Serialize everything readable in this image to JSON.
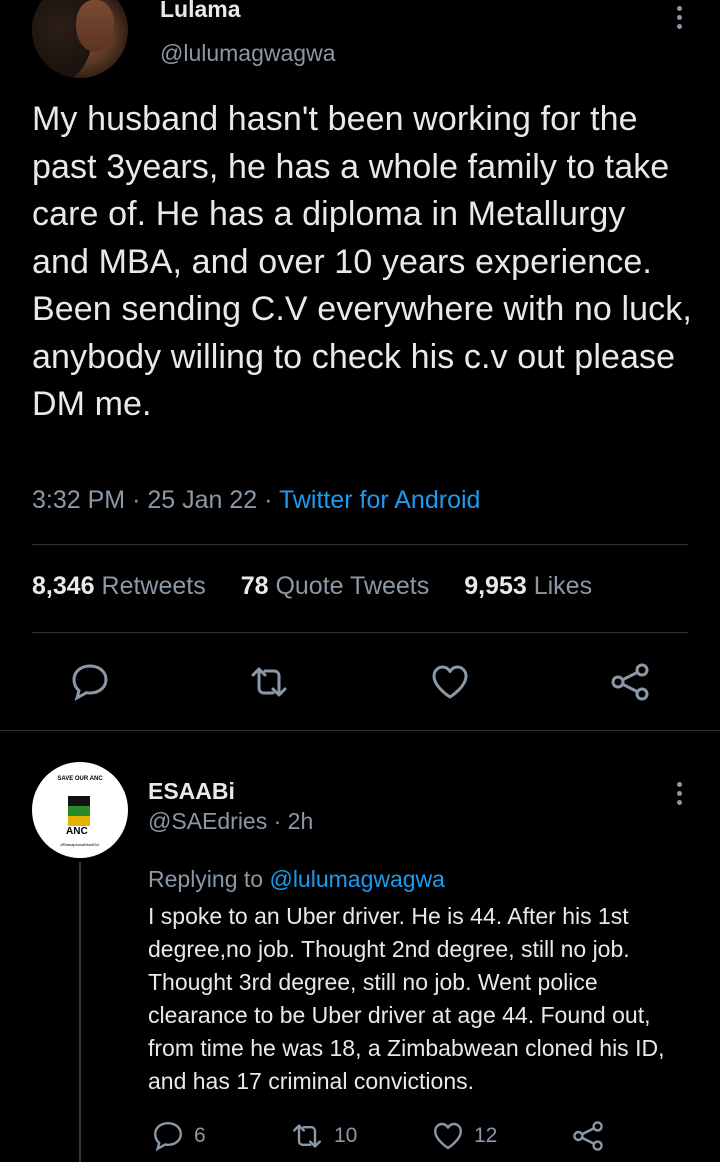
{
  "tweet": {
    "author_name": "Lulama",
    "author_handle": "@lulumagwagwa",
    "text": "My husband hasn't been working for the past 3years, he has a whole family to take care of. He has a diploma in Metallurgy and MBA, and over 10 years experience. Been sending C.V everywhere with no luck, anybody willing to check his c.v out please DM me.",
    "time": "3:32 PM",
    "date": "25 Jan 22",
    "source": "Twitter for Android",
    "separator": "·",
    "stats": {
      "retweets_count": "8,346",
      "retweets_label": "Retweets",
      "quotes_count": "78",
      "quotes_label": "Quote Tweets",
      "likes_count": "9,953",
      "likes_label": "Likes"
    }
  },
  "reply": {
    "author_name": "ESAABi",
    "author_handle": "@SAEdries",
    "age": "· 2h",
    "replying_prefix": "Replying to",
    "replying_to": "@lulumagwagwa",
    "text": "I spoke to an Uber driver. He is 44. After his 1st degree,no job. Thought 2nd degree, still no job. Thought 3rd degree, still no job. Went police clearance to be Uber driver  at age 44. Found out, from time he was 18, a Zimbabwean cloned his ID, and has 17 criminal convictions.",
    "avatar_top_text": "SAVE OUR ANC",
    "avatar_logo_text": "ANC",
    "avatar_bottom_text": "#RamaphosaMustGo!",
    "counts": {
      "replies": "6",
      "retweets": "10",
      "likes": "12"
    }
  },
  "colors": {
    "background": "#000000",
    "text": "#e7e9ea",
    "muted": "#8b98a5",
    "accent": "#1d9bf0",
    "divider": "#2f3336"
  },
  "icons": [
    "reply-icon",
    "retweet-icon",
    "like-icon",
    "share-icon",
    "more-icon"
  ]
}
